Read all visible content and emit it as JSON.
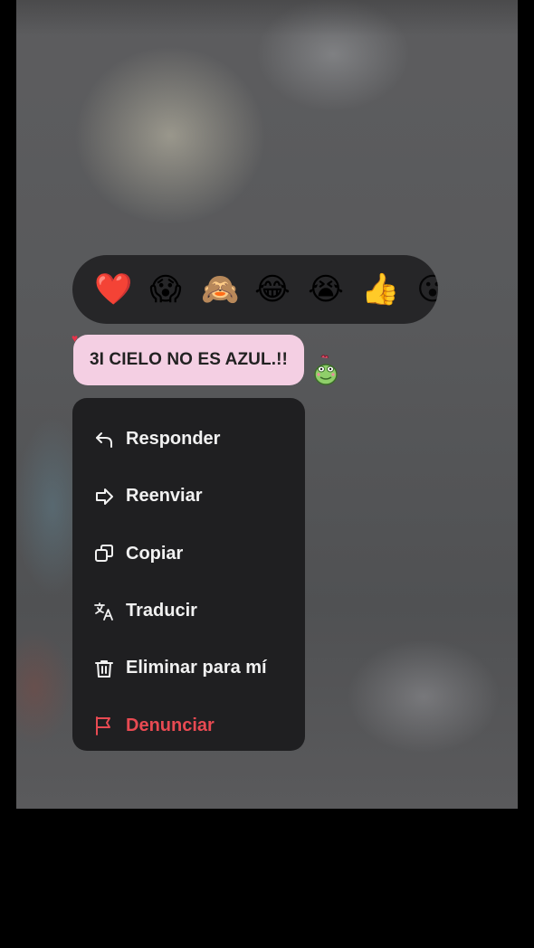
{
  "reactions": [
    {
      "name": "heart",
      "glyph": "❤️"
    },
    {
      "name": "scream",
      "glyph": "😱"
    },
    {
      "name": "see-no-evil-monkey",
      "glyph": "🙈"
    },
    {
      "name": "tears-of-joy",
      "glyph": "😂"
    },
    {
      "name": "crying",
      "glyph": "😭"
    },
    {
      "name": "thumbs-up",
      "glyph": "👍"
    },
    {
      "name": "more-emoji-partial",
      "glyph": "😮"
    }
  ],
  "message": {
    "text": "3I CIELO NO ES AZUL.!!",
    "bubble_color": "#f4cfe3"
  },
  "menu": {
    "items": [
      {
        "label": "Responder",
        "icon": "reply-icon"
      },
      {
        "label": "Reenviar",
        "icon": "forward-icon"
      },
      {
        "label": "Copiar",
        "icon": "copy-icon"
      },
      {
        "label": "Traducir",
        "icon": "translate-icon"
      },
      {
        "label": "Eliminar para mí",
        "icon": "trash-icon"
      },
      {
        "label": "Denunciar",
        "icon": "flag-icon"
      }
    ]
  },
  "colors": {
    "menu_background": "#1f1f21",
    "danger": "#e84a52",
    "reaction_bar": "#262628"
  }
}
